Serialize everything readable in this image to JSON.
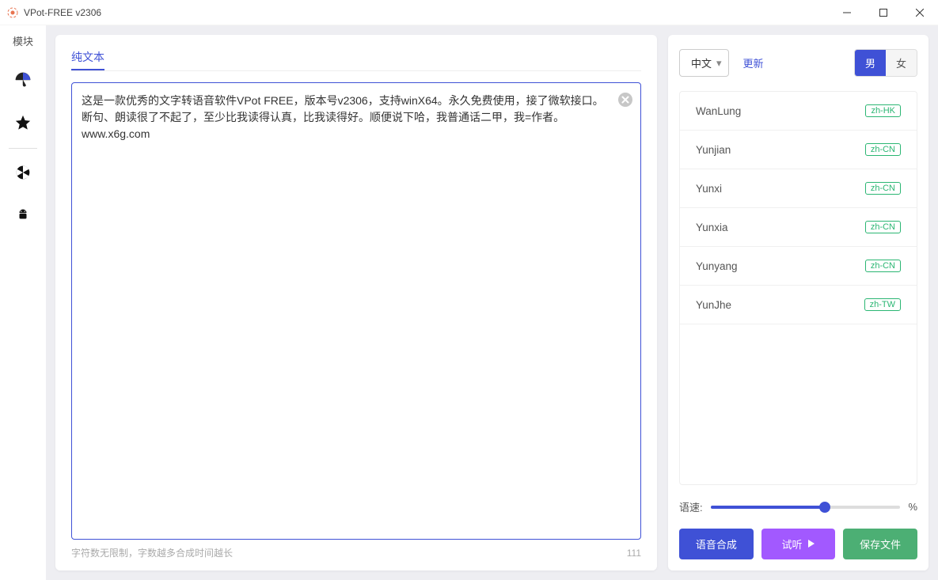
{
  "window": {
    "title": "VPot-FREE v2306"
  },
  "sidebar": {
    "label": "模块"
  },
  "tabs": {
    "text": "纯文本"
  },
  "textarea": {
    "value": "这是一款优秀的文字转语音软件VPot FREE，版本号v2306，支持winX64。永久免费使用，接了微软接口。断句、朗读很了不起了，至少比我读得认真，比我读得好。顺便说下哈，我普通话二甲，我=作者。www.x6g.com"
  },
  "footer": {
    "hint": "字符数无限制，字数越多合成时间越长",
    "count": "111"
  },
  "right": {
    "langLabel": "中文",
    "update": "更新",
    "gender": {
      "male": "男",
      "female": "女"
    },
    "voices": [
      {
        "name": "WanLung",
        "locale": "zh-HK"
      },
      {
        "name": "Yunjian",
        "locale": "zh-CN"
      },
      {
        "name": "Yunxi",
        "locale": "zh-CN"
      },
      {
        "name": "Yunxia",
        "locale": "zh-CN"
      },
      {
        "name": "Yunyang",
        "locale": "zh-CN"
      },
      {
        "name": "YunJhe",
        "locale": "zh-TW"
      }
    ],
    "speedLabel": "语速:",
    "speedUnit": "%",
    "buttons": {
      "synth": "语音合成",
      "preview": "试听",
      "save": "保存文件"
    }
  }
}
